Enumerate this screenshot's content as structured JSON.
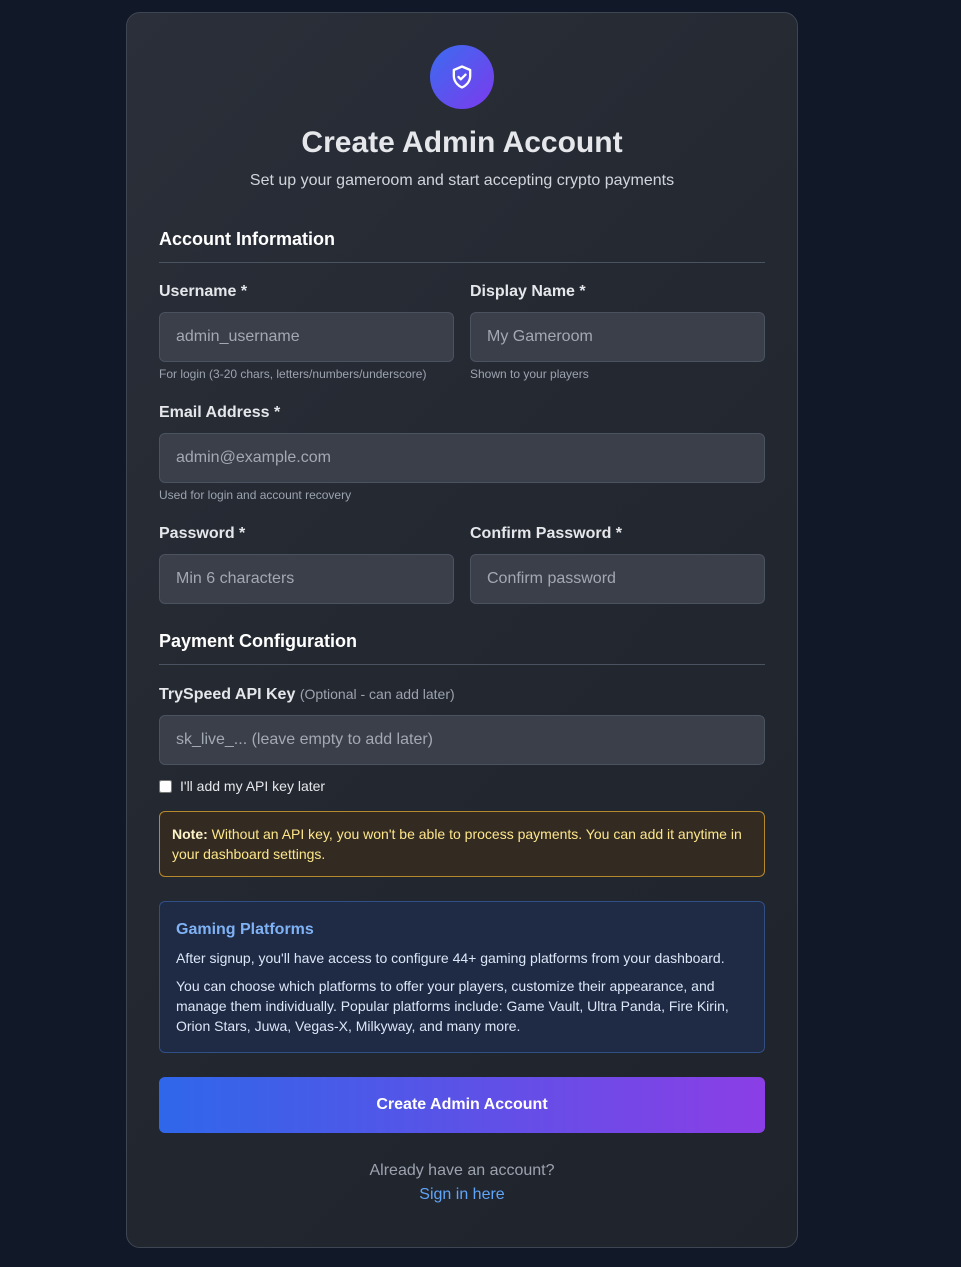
{
  "header": {
    "title": "Create Admin Account",
    "subtitle": "Set up your gameroom and start accepting crypto payments",
    "logo_icon": "shield-check-icon"
  },
  "account_section": {
    "title": "Account Information",
    "username": {
      "label": "Username *",
      "placeholder": "admin_username",
      "help": "For login (3-20 chars, letters/numbers/underscore)"
    },
    "display_name": {
      "label": "Display Name *",
      "placeholder": "My Gameroom",
      "help": "Shown to your players"
    },
    "email": {
      "label": "Email Address *",
      "placeholder": "admin@example.com",
      "help": "Used for login and account recovery"
    },
    "password": {
      "label": "Password *",
      "placeholder": "Min 6 characters"
    },
    "confirm_password": {
      "label": "Confirm Password *",
      "placeholder": "Confirm password"
    }
  },
  "payment_section": {
    "title": "Payment Configuration",
    "api_key": {
      "label": "TrySpeed API Key",
      "label_optional": "(Optional - can add later)",
      "placeholder": "sk_live_... (leave empty to add later)"
    },
    "add_later_checkbox": {
      "label": "I'll add my API key later",
      "checked": false
    },
    "note": {
      "strong": "Note:",
      "text": " Without an API key, you won't be able to process payments. You can add it anytime in your dashboard settings."
    }
  },
  "platforms_box": {
    "title": "Gaming Platforms",
    "text1": "After signup, you'll have access to configure 44+ gaming platforms from your dashboard.",
    "text2": "You can choose which platforms to offer your players, customize their appearance, and manage them individually. Popular platforms include: Game Vault, Ultra Panda, Fire Kirin, Orion Stars, Juwa, Vegas-X, Milkyway, and many more."
  },
  "submit": {
    "label": "Create Admin Account"
  },
  "footer": {
    "question": "Already have an account?",
    "link": "Sign in here"
  },
  "colors": {
    "page_bg": "#111827",
    "accent_start": "#2f67ea",
    "accent_end": "#8b3ee6",
    "link": "#60a5fa",
    "note_border": "#b8892b",
    "platform_title": "#7fb2f5"
  }
}
